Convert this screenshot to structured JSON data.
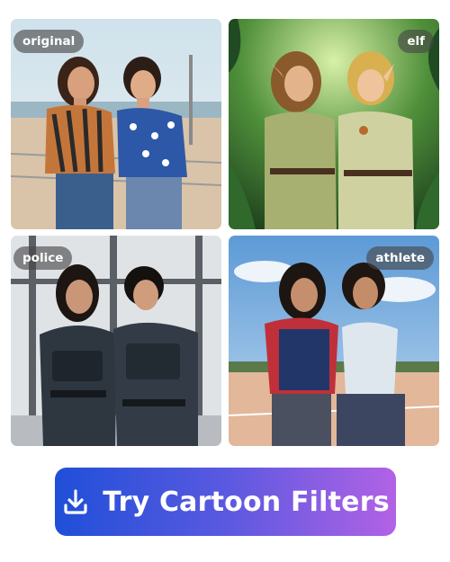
{
  "tiles": [
    {
      "label": "original",
      "badge_side": "left",
      "image": "photo-two-women-at-beach-boardwalk"
    },
    {
      "label": "elf",
      "badge_side": "right",
      "image": "cartoon-elf-women-in-jungle"
    },
    {
      "label": "police",
      "badge_side": "left",
      "image": "cartoon-women-in-tactical-police-gear"
    },
    {
      "label": "athlete",
      "badge_side": "right",
      "image": "cartoon-women-athletes-on-track"
    }
  ],
  "cta": {
    "label": "Try Cartoon Filters",
    "icon": "download-icon",
    "gradient": [
      "#1f4fd8",
      "#5a59e0",
      "#b262e5"
    ]
  },
  "colors": {
    "badge_bg": "#464646",
    "badge_text": "#ffffff",
    "page_bg": "#ffffff"
  }
}
